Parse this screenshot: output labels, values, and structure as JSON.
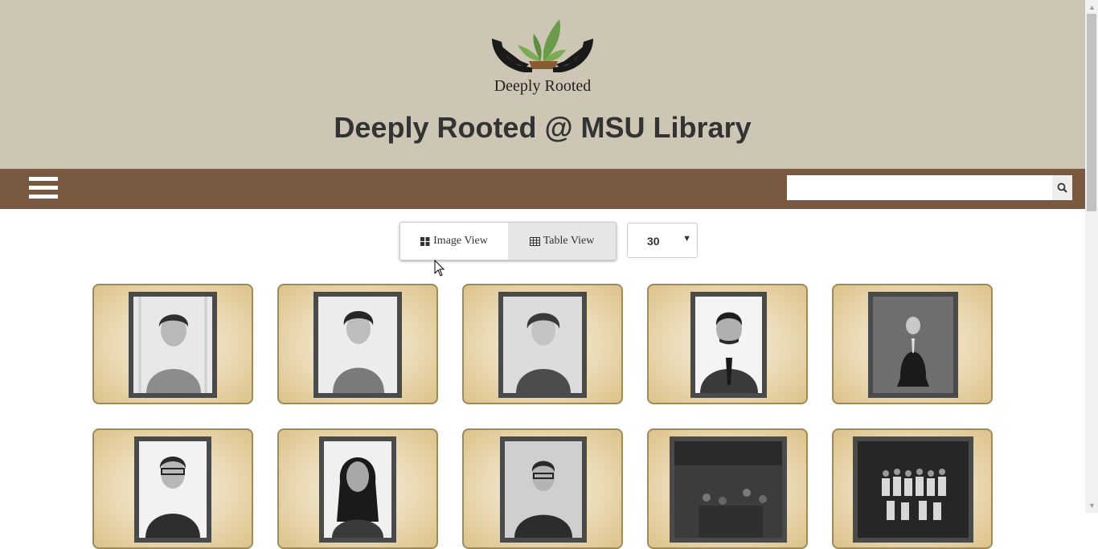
{
  "header": {
    "logo_text": "Deeply Rooted",
    "title": "Deeply Rooted @ MSU Library"
  },
  "navbar": {
    "menu_icon": "hamburger-menu-icon",
    "search": {
      "value": "",
      "placeholder": "",
      "icon": "search-icon"
    }
  },
  "view_toggle": {
    "image_view_label": "Image View",
    "table_view_label": "Table View",
    "active": "Image View",
    "image_view_icon": "grid-icon",
    "table_view_icon": "table-icon"
  },
  "per_page": {
    "selected": "30"
  },
  "colors": {
    "header_bg": "#cdc6b4",
    "nav_bg": "#795a40",
    "title_color": "#333333",
    "thumb_border": "#9e8a5a",
    "thumb_bg": "#ead9b3"
  },
  "gallery": {
    "items": [
      {
        "subject": "woman-portrait"
      },
      {
        "subject": "woman-portrait"
      },
      {
        "subject": "woman-portrait"
      },
      {
        "subject": "man-portrait"
      },
      {
        "subject": "man-seated-portrait"
      },
      {
        "subject": "man-portrait"
      },
      {
        "subject": "woman-portrait"
      },
      {
        "subject": "man-portrait"
      },
      {
        "subject": "crowd-photo"
      },
      {
        "subject": "group-photo"
      }
    ]
  }
}
